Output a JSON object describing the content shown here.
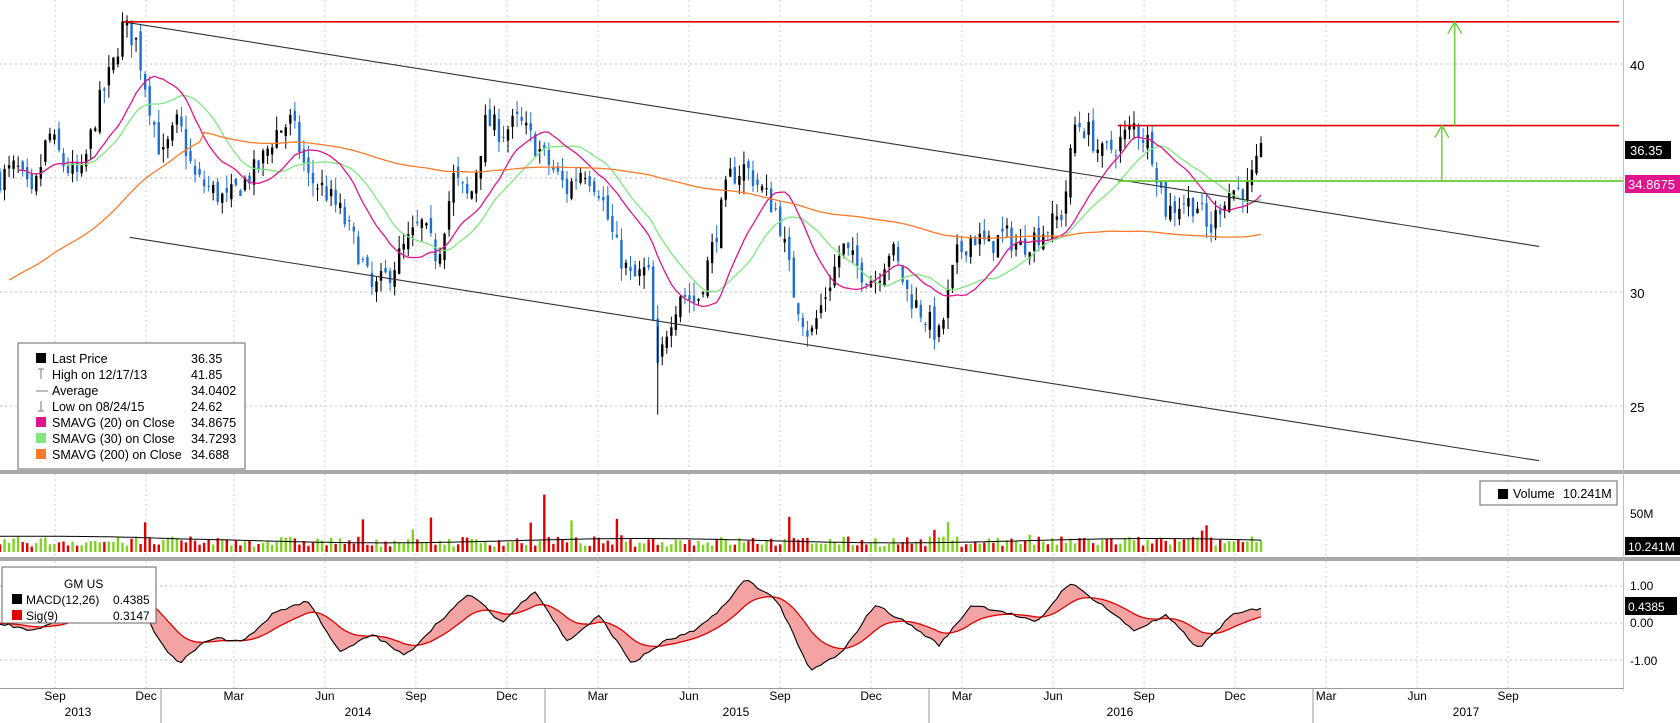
{
  "colors": {
    "up": "#000000",
    "down": "#1f6fd1",
    "sma20": "#e0148c",
    "sma30": "#7ee87e",
    "sma200": "#ff7a2a",
    "resistance": "#e00000",
    "target": "#66cc33",
    "channel": "#333333",
    "vol_up": "#7ed321",
    "vol_down": "#e00000",
    "macd": "#000000",
    "signal": "#e00000"
  },
  "price_legend": {
    "rows": [
      {
        "icon": "black-square-icon",
        "label": "Last Price",
        "value": "36.35"
      },
      {
        "icon": "high-marker-icon",
        "label": "High on 12/17/13",
        "value": "41.85"
      },
      {
        "icon": "average-marker-icon",
        "label": "Average",
        "value": "34.0402"
      },
      {
        "icon": "low-marker-icon",
        "label": "Low on 08/24/15",
        "value": "24.62"
      },
      {
        "icon": "magenta-square-icon",
        "label": "SMAVG (20) on Close",
        "value": "34.8675"
      },
      {
        "icon": "green-square-icon",
        "label": "SMAVG (30) on Close",
        "value": "34.7293"
      },
      {
        "icon": "orange-square-icon",
        "label": "SMAVG (200) on Close",
        "value": "34.688"
      }
    ]
  },
  "volume_legend": {
    "label": "Volume",
    "value": "10.241M"
  },
  "macd_legend": {
    "title": "GM US",
    "rows": [
      {
        "label": "MACD(12,26)",
        "value": "0.4385"
      },
      {
        "label": "Sig(9)",
        "value": "0.3147"
      }
    ]
  },
  "tags": {
    "last_price": "36.35",
    "sma20": "34.8675",
    "volume": "10.241M",
    "macd": "0.4385"
  },
  "chart_data": [
    {
      "type": "candlestick",
      "ticker": "GM US",
      "y_axis": {
        "ticks": [
          "25",
          "30",
          "35",
          "40"
        ],
        "ylim": [
          22.5,
          42.8
        ],
        "position": "right"
      },
      "x_axis": {
        "months": [
          "Sep",
          "Dec",
          "Mar",
          "Jun",
          "Sep",
          "Dec",
          "Mar",
          "Jun",
          "Sep",
          "Dec",
          "Mar",
          "Jun",
          "Sep",
          "Dec",
          "Mar",
          "Jun",
          "Sep"
        ],
        "years": [
          "2013",
          "2014",
          "2015",
          "2016",
          "2017"
        ]
      },
      "price_path": [
        {
          "t": 0,
          "v": 35.0
        },
        {
          "t": 0.5,
          "v": 35.5
        },
        {
          "t": 1.0,
          "v": 34.0
        },
        {
          "t": 1.5,
          "v": 37.0
        },
        {
          "t": 2.0,
          "v": 35.5
        },
        {
          "t": 2.5,
          "v": 35.0
        },
        {
          "t": 3.0,
          "v": 38.0
        },
        {
          "t": 3.5,
          "v": 40.0
        },
        {
          "t": 3.8,
          "v": 41.7
        },
        {
          "t": 4.2,
          "v": 41.0
        },
        {
          "t": 4.5,
          "v": 39.0
        },
        {
          "t": 5.0,
          "v": 35.8
        },
        {
          "t": 5.5,
          "v": 37.5
        },
        {
          "t": 6.0,
          "v": 35.0
        },
        {
          "t": 6.5,
          "v": 34.5
        },
        {
          "t": 7.0,
          "v": 34.0
        },
        {
          "t": 7.5,
          "v": 34.8
        },
        {
          "t": 8.0,
          "v": 35.5
        },
        {
          "t": 8.5,
          "v": 37.0
        },
        {
          "t": 9.0,
          "v": 37.5
        },
        {
          "t": 9.5,
          "v": 35.0
        },
        {
          "t": 10.0,
          "v": 34.5
        },
        {
          "t": 10.5,
          "v": 33.5
        },
        {
          "t": 11.0,
          "v": 32.0
        },
        {
          "t": 11.5,
          "v": 30.0
        },
        {
          "t": 12.0,
          "v": 30.8
        },
        {
          "t": 12.5,
          "v": 32.0
        },
        {
          "t": 13.0,
          "v": 33.0
        },
        {
          "t": 13.5,
          "v": 31.5
        },
        {
          "t": 14.0,
          "v": 35.0
        },
        {
          "t": 14.5,
          "v": 34.0
        },
        {
          "t": 15.0,
          "v": 37.5
        },
        {
          "t": 15.5,
          "v": 37.0
        },
        {
          "t": 16.0,
          "v": 37.5
        },
        {
          "t": 16.5,
          "v": 36.5
        },
        {
          "t": 17.0,
          "v": 35.5
        },
        {
          "t": 17.5,
          "v": 34.5
        },
        {
          "t": 18.0,
          "v": 35.5
        },
        {
          "t": 18.5,
          "v": 34.5
        },
        {
          "t": 19.0,
          "v": 32.0
        },
        {
          "t": 19.5,
          "v": 30.5
        },
        {
          "t": 20.0,
          "v": 31.0
        },
        {
          "t": 20.3,
          "v": 26.5
        },
        {
          "t": 20.6,
          "v": 28.5
        },
        {
          "t": 21.0,
          "v": 30.0
        },
        {
          "t": 21.5,
          "v": 29.5
        },
        {
          "t": 22.0,
          "v": 32.0
        },
        {
          "t": 22.5,
          "v": 35.0
        },
        {
          "t": 23.0,
          "v": 35.5
        },
        {
          "t": 23.5,
          "v": 34.5
        },
        {
          "t": 24.0,
          "v": 33.5
        },
        {
          "t": 24.5,
          "v": 30.0
        },
        {
          "t": 25.0,
          "v": 28.0
        },
        {
          "t": 25.5,
          "v": 30.0
        },
        {
          "t": 26.0,
          "v": 32.0
        },
        {
          "t": 26.5,
          "v": 31.0
        },
        {
          "t": 27.0,
          "v": 30.5
        },
        {
          "t": 27.5,
          "v": 32.0
        },
        {
          "t": 28.0,
          "v": 30.0
        },
        {
          "t": 28.5,
          "v": 29.0
        },
        {
          "t": 29.0,
          "v": 28.0
        },
        {
          "t": 29.5,
          "v": 31.5
        },
        {
          "t": 30.0,
          "v": 32.5
        },
        {
          "t": 30.5,
          "v": 32.0
        },
        {
          "t": 31.0,
          "v": 32.5
        },
        {
          "t": 31.5,
          "v": 32.0
        },
        {
          "t": 32.0,
          "v": 32.5
        },
        {
          "t": 32.5,
          "v": 33.0
        },
        {
          "t": 32.8,
          "v": 33.5
        },
        {
          "t": 33.2,
          "v": 37.5
        },
        {
          "t": 33.6,
          "v": 37.0
        },
        {
          "t": 34.0,
          "v": 36.0
        },
        {
          "t": 34.5,
          "v": 36.5
        },
        {
          "t": 35.0,
          "v": 37.3
        },
        {
          "t": 35.5,
          "v": 36.5
        },
        {
          "t": 36.0,
          "v": 33.5
        },
        {
          "t": 36.5,
          "v": 34.0
        },
        {
          "t": 37.0,
          "v": 33.8
        },
        {
          "t": 37.3,
          "v": 32.5
        },
        {
          "t": 37.7,
          "v": 34.0
        },
        {
          "t": 38.0,
          "v": 34.5
        },
        {
          "t": 38.5,
          "v": 34.5
        },
        {
          "t": 38.8,
          "v": 35.5
        },
        {
          "t": 39.0,
          "v": 36.35
        }
      ],
      "channel": {
        "upper": [
          {
            "t": 3.8,
            "v": 41.85
          },
          {
            "t": 47.5,
            "v": 32.0
          }
        ],
        "lower": [
          {
            "t": 4.0,
            "v": 32.4
          },
          {
            "t": 47.5,
            "v": 22.6
          }
        ]
      },
      "resistance_lines": [
        {
          "value": 41.85,
          "from_t": 3.8,
          "to_t": 47.5
        },
        {
          "value": 37.3,
          "from_t": 34.5,
          "to_t": 47.5
        }
      ],
      "target_line": {
        "value": 34.8675,
        "from_t": 34.5,
        "to_t": 47.5
      },
      "target_arrows": [
        {
          "t": 44.9,
          "from": 37.3,
          "to": 41.85
        },
        {
          "t": 44.5,
          "from": 34.8675,
          "to": 37.3
        }
      ]
    },
    {
      "type": "bar",
      "title": "Volume",
      "y_axis": {
        "ticks": [
          "50M"
        ],
        "ylim": [
          0,
          72
        ]
      },
      "last_value_millions": 10.241
    },
    {
      "type": "line",
      "title": "MACD",
      "y_axis": {
        "ticks": [
          "1.00",
          "0.00",
          "-1.00"
        ],
        "ylim": [
          -1.7,
          1.2
        ]
      },
      "macd_path": [
        {
          "t": 0,
          "v": 0.0
        },
        {
          "t": 1,
          "v": -0.2
        },
        {
          "t": 2,
          "v": 0.1
        },
        {
          "t": 3,
          "v": 0.8
        },
        {
          "t": 4,
          "v": 1.0
        },
        {
          "t": 5,
          "v": -0.6
        },
        {
          "t": 5.5,
          "v": -1.1
        },
        {
          "t": 6.5,
          "v": -0.4
        },
        {
          "t": 7.5,
          "v": -0.5
        },
        {
          "t": 8.5,
          "v": 0.3
        },
        {
          "t": 9.5,
          "v": 0.6
        },
        {
          "t": 10.5,
          "v": -0.8
        },
        {
          "t": 11.5,
          "v": -0.3
        },
        {
          "t": 12.5,
          "v": -0.9
        },
        {
          "t": 13.5,
          "v": 0.0
        },
        {
          "t": 14.5,
          "v": 0.8
        },
        {
          "t": 15.5,
          "v": 0.0
        },
        {
          "t": 16.5,
          "v": 0.9
        },
        {
          "t": 17.5,
          "v": -0.5
        },
        {
          "t": 18.5,
          "v": 0.2
        },
        {
          "t": 19.5,
          "v": -1.1
        },
        {
          "t": 20.5,
          "v": -0.5
        },
        {
          "t": 21.5,
          "v": -0.2
        },
        {
          "t": 22.5,
          "v": 0.6
        },
        {
          "t": 23.0,
          "v": 1.2
        },
        {
          "t": 24.0,
          "v": 0.6
        },
        {
          "t": 25.0,
          "v": -1.3
        },
        {
          "t": 26.0,
          "v": -0.8
        },
        {
          "t": 27.0,
          "v": 0.5
        },
        {
          "t": 28.0,
          "v": 0.0
        },
        {
          "t": 29.0,
          "v": -0.6
        },
        {
          "t": 30.0,
          "v": 0.5
        },
        {
          "t": 31.0,
          "v": 0.3
        },
        {
          "t": 32.0,
          "v": 0.0
        },
        {
          "t": 33.0,
          "v": 1.1
        },
        {
          "t": 34.0,
          "v": 0.5
        },
        {
          "t": 35.0,
          "v": -0.2
        },
        {
          "t": 36.0,
          "v": 0.2
        },
        {
          "t": 37.0,
          "v": -0.7
        },
        {
          "t": 38.0,
          "v": 0.2
        },
        {
          "t": 39.0,
          "v": 0.4385
        }
      ]
    }
  ]
}
